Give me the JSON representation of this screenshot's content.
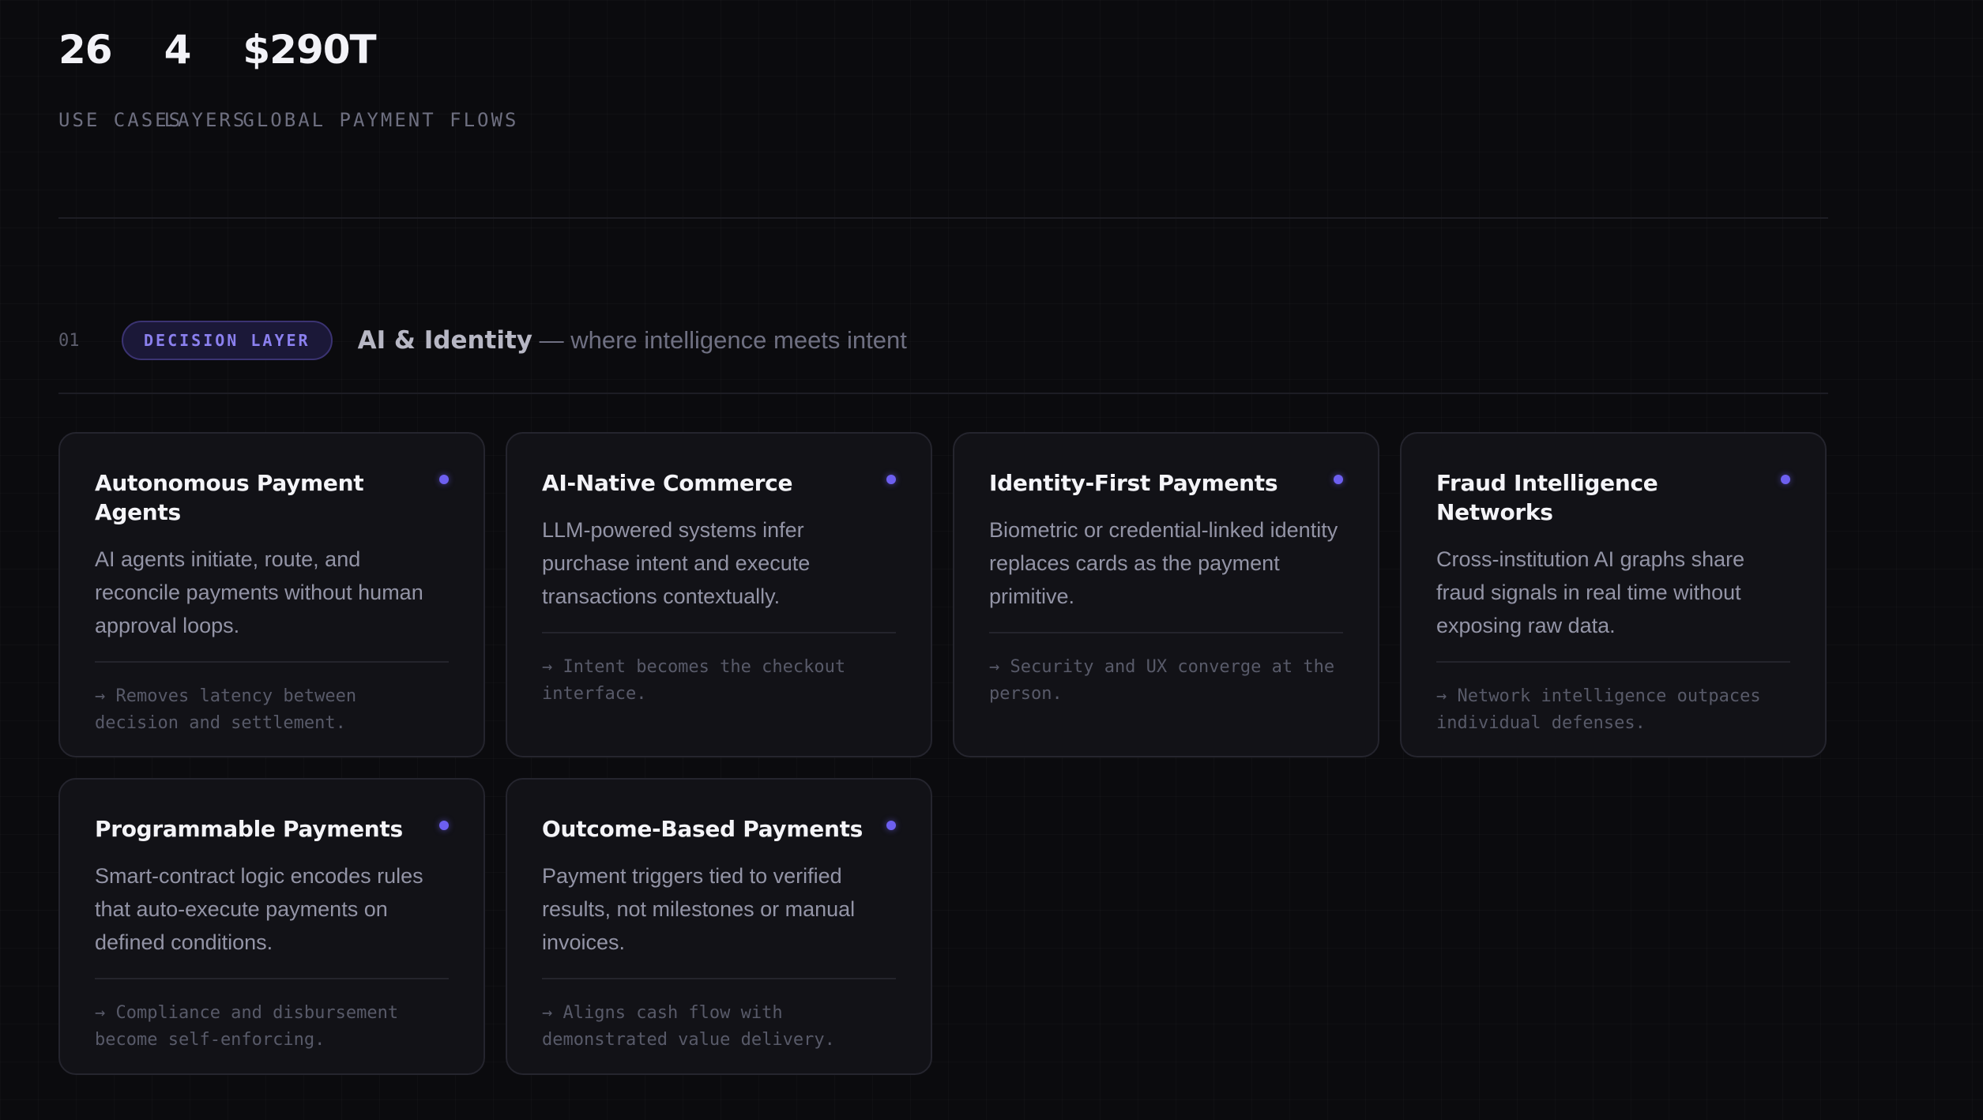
{
  "stats": [
    {
      "value": "26",
      "label": "USE CASES"
    },
    {
      "value": "4",
      "label": "LAYERS"
    },
    {
      "value": "$290T",
      "label": "GLOBAL PAYMENT FLOWS"
    }
  ],
  "section": {
    "number": "01",
    "badge": "DECISION LAYER",
    "title": "AI & Identity",
    "subtitle": " — where intelligence meets intent"
  },
  "cards": [
    {
      "title": "Autonomous Payment Agents",
      "description": "AI agents initiate, route, and reconcile payments without human approval loops.",
      "note": "→ Removes latency between decision and settlement."
    },
    {
      "title": "AI-Native Commerce",
      "description": "LLM-powered systems infer purchase intent and execute transactions contextually.",
      "note": "→ Intent becomes the checkout interface."
    },
    {
      "title": "Identity-First Payments",
      "description": "Biometric or credential-linked identity replaces cards as the payment primitive.",
      "note": "→ Security and UX converge at the person."
    },
    {
      "title": "Fraud Intelligence Networks",
      "description": "Cross-institution AI graphs share fraud signals in real time without exposing raw data.",
      "note": "→ Network intelligence outpaces individual defenses."
    },
    {
      "title": "Programmable Payments",
      "description": "Smart-contract logic encodes rules that auto-execute payments on defined conditions.",
      "note": "→ Compliance and disbursement become self-enforcing."
    },
    {
      "title": "Outcome-Based Payments",
      "description": "Payment triggers tied to verified results, not milestones or manual invoices.",
      "note": "→ Aligns cash flow with demonstrated value delivery."
    }
  ],
  "colors": {
    "accent": "#6d5ff0",
    "background": "#0b0b0e",
    "card": "#121217"
  }
}
